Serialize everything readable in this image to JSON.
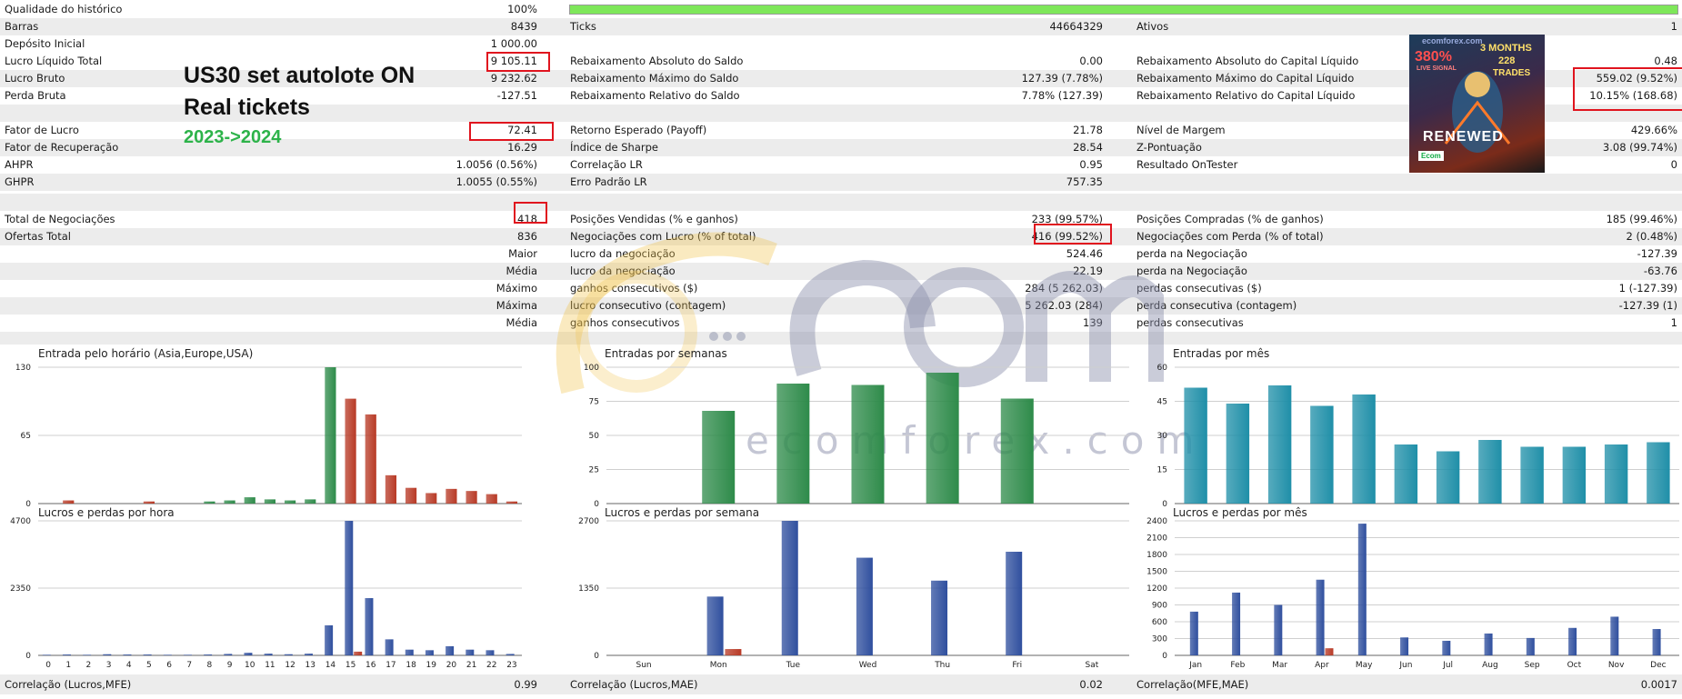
{
  "quality": {
    "label": "Qualidade do histórico",
    "value": "100%",
    "fill_fraction": 1.0
  },
  "summary": {
    "bars_label": "Barras",
    "bars_value": "8439",
    "ticks_label": "Ticks",
    "ticks_value": "44664329",
    "assets_label": "Ativos",
    "assets_value": "1",
    "deposit_label": "Depósito Inicial",
    "deposit_value": "1 000.00"
  },
  "rows": [
    {
      "l1": "Lucro Líquido Total",
      "v1": "9 105.11",
      "l2": "Rebaixamento Absoluto do Saldo",
      "v2": "0.00",
      "l3": "Rebaixamento Absoluto do Capital Líquido",
      "v3": "0.48"
    },
    {
      "l1": "Lucro Bruto",
      "v1": "9 232.62",
      "l2": "Rebaixamento Máximo do Saldo",
      "v2": "127.39 (7.78%)",
      "l3": "Rebaixamento Máximo do Capital Líquido",
      "v3": "559.02 (9.52%)"
    },
    {
      "l1": "Perda Bruta",
      "v1": "-127.51",
      "l2": "Rebaixamento Relativo do Saldo",
      "v2": "7.78% (127.39)",
      "l3": "Rebaixamento Relativo do Capital Líquido",
      "v3": "10.15% (168.68)"
    },
    {
      "l1": "Fator de Lucro",
      "v1": "72.41",
      "l2": "Retorno Esperado (Payoff)",
      "v2": "21.78",
      "l3": "Nível de Margem",
      "v3": "429.66%"
    },
    {
      "l1": "Fator de Recuperação",
      "v1": "16.29",
      "l2": "Índice de Sharpe",
      "v2": "28.54",
      "l3": "Z-Pontuação",
      "v3": "3.08 (99.74%)"
    },
    {
      "l1": "AHPR",
      "v1": "1.0056 (0.56%)",
      "l2": "Correlação LR",
      "v2": "0.95",
      "l3": "Resultado OnTester",
      "v3": "0"
    },
    {
      "l1": "GHPR",
      "v1": "1.0055 (0.55%)",
      "l2": "Erro Padrão LR",
      "v2": "757.35",
      "l3": "",
      "v3": ""
    }
  ],
  "trades": [
    {
      "l1": "Total de Negociações",
      "v1": "418",
      "l2": "Posições Vendidas (% e ganhos)",
      "v2": "233 (99.57%)",
      "l3": "Posições Compradas (% de ganhos)",
      "v3": "185 (99.46%)"
    },
    {
      "l1": "Ofertas Total",
      "v1": "836",
      "l2": "Negociações com Lucro (% of total)",
      "v2": "416 (99.52%)",
      "l3": "Negociações com Perda (% of total)",
      "v3": "2 (0.48%)"
    },
    {
      "l1": "",
      "v1": "Maior",
      "l2": "lucro da negociação",
      "v2": "524.46",
      "l3": "perda na Negociação",
      "v3": "-127.39"
    },
    {
      "l1": "",
      "v1": "Média",
      "l2": "lucro da negociação",
      "v2": "22.19",
      "l3": "perda na Negociação",
      "v3": "-63.76"
    },
    {
      "l1": "",
      "v1": "Máximo",
      "l2": "ganhos consecutivos ($)",
      "v2": "284 (5 262.03)",
      "l3": "perdas consecutivas ($)",
      "v3": "1 (-127.39)"
    },
    {
      "l1": "",
      "v1": "Máxima",
      "l2": "lucro consecutivo (contagem)",
      "v2": "5 262.03 (284)",
      "l3": "perda consecutiva (contagem)",
      "v3": "-127.39 (1)"
    },
    {
      "l1": "",
      "v1": "Média",
      "l2": "ganhos consecutivos",
      "v2": "139",
      "l3": "perdas consecutivas",
      "v3": "1"
    }
  ],
  "correlation": {
    "l1": "Correlação (Lucros,MFE)",
    "v1": "0.99",
    "l2": "Correlação (Lucros,MAE)",
    "v2": "0.02",
    "l3": "Correlação(MFE,MAE)",
    "v3": "0.0017"
  },
  "overlay": {
    "line1": "US30 set autolote ON",
    "line2": "Real tickets",
    "line3": "2023->2024",
    "line3_color": "#2db34a"
  },
  "ad": {
    "site": "ecomforex.com",
    "pct": "380%",
    "live": "LIVE SIGNAL",
    "months": "3 MONTHS",
    "trades": "228",
    "trades_word": "TRADES",
    "renewed": "RENEWED",
    "brand": "Ecom"
  },
  "watermark": {
    "text": "ecomforex.com",
    "logo": "Ecom"
  },
  "colors": {
    "highlight": "#e0141e",
    "green": "#2e8b4a",
    "red": "#b83a26",
    "blue": "#2f4f9e",
    "teal": "#1f8fa8",
    "quality_fill": "#7ee75a"
  },
  "chart_data": [
    {
      "type": "bar",
      "title": "Entrada pelo horário (Asia,Europe,USA)",
      "categories": [
        "0",
        "1",
        "2",
        "3",
        "4",
        "5",
        "6",
        "7",
        "8",
        "9",
        "10",
        "11",
        "12",
        "13",
        "14",
        "15",
        "16",
        "17",
        "18",
        "19",
        "20",
        "21",
        "22",
        "23"
      ],
      "yticks": [
        "0",
        "65",
        "130"
      ],
      "ylim": [
        0,
        130
      ],
      "series": [
        {
          "color": "#2e8b4a",
          "values": [
            0,
            0,
            0,
            0,
            0,
            0,
            0,
            0,
            2,
            3,
            6,
            4,
            3,
            4,
            130,
            0,
            0,
            0,
            0,
            0,
            0,
            0,
            0,
            0
          ]
        },
        {
          "color": "#b83a26",
          "values": [
            0,
            3,
            0,
            0,
            0,
            2,
            0,
            0,
            0,
            0,
            0,
            0,
            0,
            0,
            0,
            100,
            85,
            27,
            15,
            10,
            14,
            12,
            9,
            2
          ]
        }
      ]
    },
    {
      "type": "bar",
      "title": "Entradas por semanas",
      "categories": [
        "Sun",
        "Mon",
        "Tue",
        "Wed",
        "Thu",
        "Fri",
        "Sat"
      ],
      "yticks": [
        "0",
        "25",
        "50",
        "75",
        "100"
      ],
      "ylim": [
        0,
        100
      ],
      "series": [
        {
          "color": "#2e8b4a",
          "values": [
            0,
            68,
            88,
            87,
            96,
            77,
            0
          ]
        }
      ]
    },
    {
      "type": "bar",
      "title": "Entradas por mês",
      "categories": [
        "Jan",
        "Feb",
        "Mar",
        "Apr",
        "May",
        "Jun",
        "Jul",
        "Aug",
        "Sep",
        "Oct",
        "Nov",
        "Dec"
      ],
      "yticks": [
        "0",
        "15",
        "30",
        "45",
        "60"
      ],
      "ylim": [
        0,
        60
      ],
      "series": [
        {
          "color": "#1f8fa8",
          "values": [
            51,
            44,
            52,
            43,
            48,
            26,
            23,
            28,
            25,
            25,
            26,
            27
          ]
        }
      ]
    },
    {
      "type": "bar",
      "title": "Lucros e perdas por hora",
      "categories": [
        "0",
        "1",
        "2",
        "3",
        "4",
        "5",
        "6",
        "7",
        "8",
        "9",
        "10",
        "11",
        "12",
        "13",
        "14",
        "15",
        "16",
        "17",
        "18",
        "19",
        "20",
        "21",
        "22",
        "23"
      ],
      "yticks": [
        "0",
        "2350",
        "4700"
      ],
      "ylim": [
        0,
        4700
      ],
      "series": [
        {
          "color": "#2f4f9e",
          "values": [
            20,
            30,
            20,
            40,
            30,
            30,
            20,
            20,
            30,
            50,
            90,
            60,
            40,
            60,
            1050,
            4700,
            2000,
            560,
            200,
            180,
            320,
            200,
            180,
            50
          ]
        },
        {
          "color": "#b83a26",
          "values": [
            0,
            0,
            0,
            0,
            0,
            0,
            0,
            0,
            0,
            0,
            0,
            0,
            0,
            0,
            0,
            130,
            0,
            0,
            0,
            0,
            0,
            0,
            0,
            0
          ]
        }
      ]
    },
    {
      "type": "bar",
      "title": "Lucros e perdas por semana",
      "categories": [
        "Sun",
        "Mon",
        "Tue",
        "Wed",
        "Thu",
        "Fri",
        "Sat"
      ],
      "yticks": [
        "0",
        "1350",
        "2700"
      ],
      "ylim": [
        0,
        2700
      ],
      "series": [
        {
          "color": "#2f4f9e",
          "values": [
            0,
            1180,
            2700,
            1960,
            1500,
            2080,
            0
          ]
        },
        {
          "color": "#b83a26",
          "values": [
            0,
            127,
            0,
            0,
            0,
            0,
            0
          ]
        }
      ]
    },
    {
      "type": "bar",
      "title": "Lucros e perdas por mês",
      "categories": [
        "Jan",
        "Feb",
        "Mar",
        "Apr",
        "May",
        "Jun",
        "Jul",
        "Aug",
        "Sep",
        "Oct",
        "Nov",
        "Dec"
      ],
      "yticks": [
        "0",
        "300",
        "600",
        "900",
        "1200",
        "1500",
        "1800",
        "2100",
        "2400"
      ],
      "ylim": [
        0,
        2400
      ],
      "series": [
        {
          "color": "#2f4f9e",
          "values": [
            780,
            1120,
            900,
            1350,
            2350,
            320,
            260,
            390,
            310,
            490,
            690,
            470
          ]
        },
        {
          "color": "#b83a26",
          "values": [
            0,
            0,
            0,
            127,
            0,
            0,
            0,
            0,
            0,
            0,
            0,
            0
          ]
        }
      ]
    }
  ]
}
